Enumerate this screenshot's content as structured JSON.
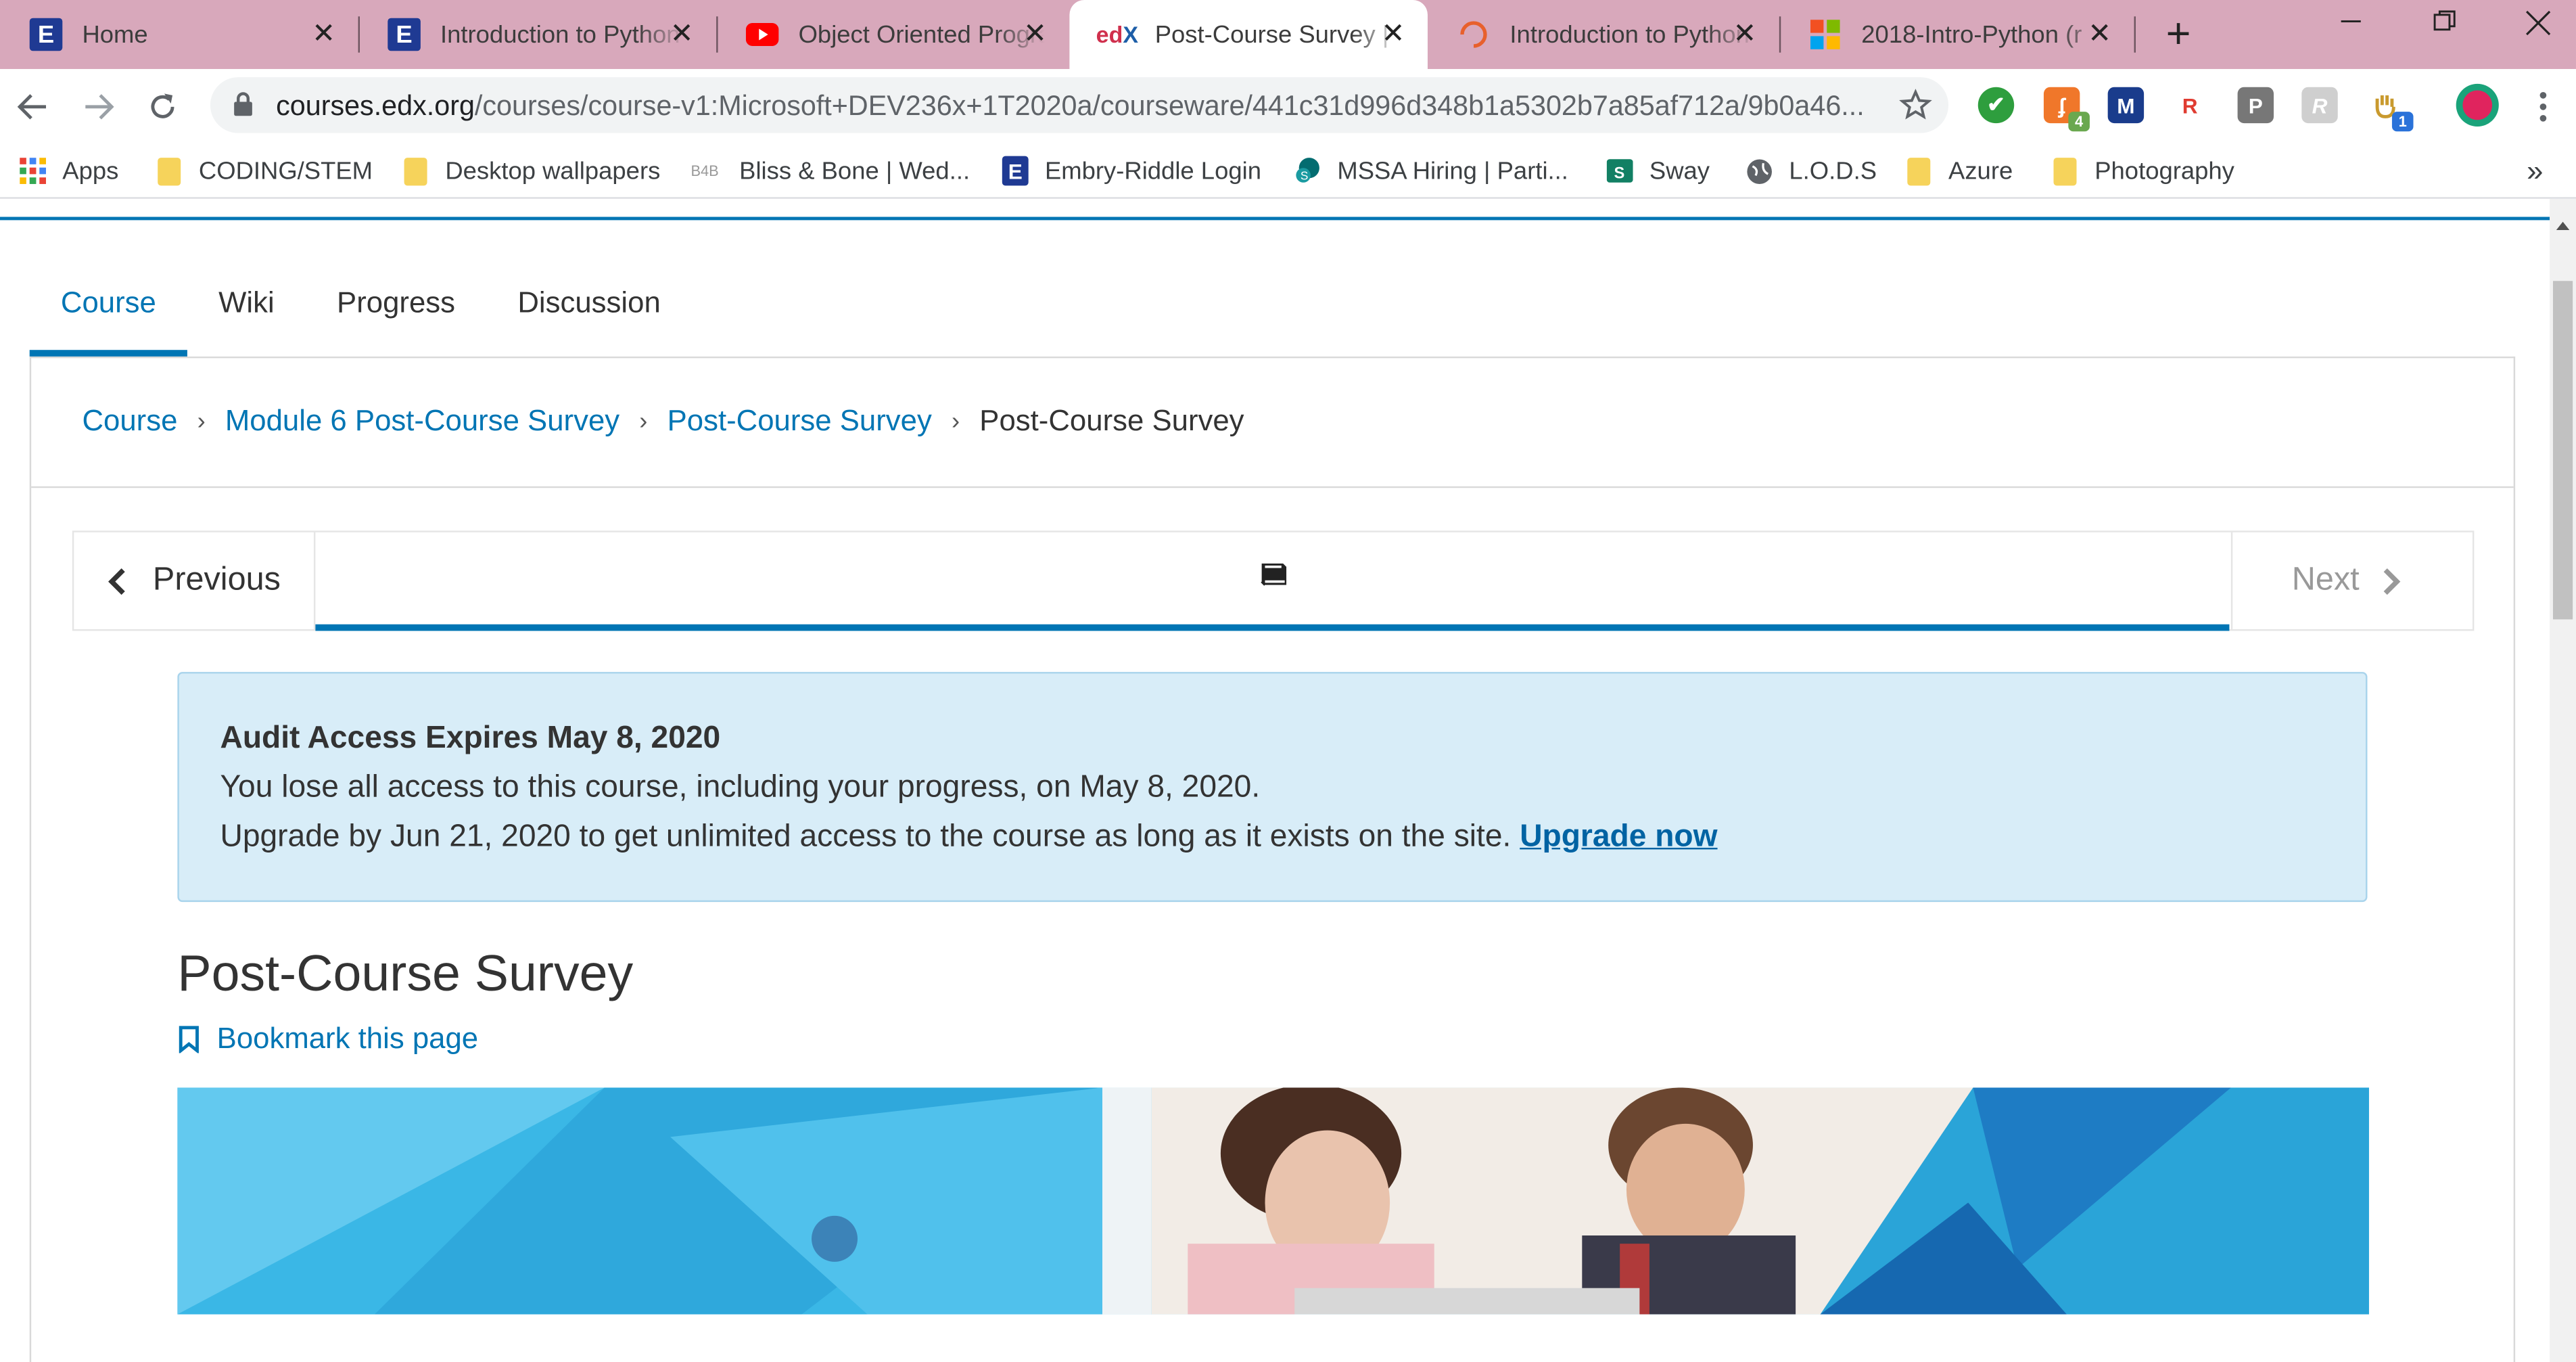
{
  "browser": {
    "tabs": [
      {
        "title": "Home",
        "icon": "edx-e-icon",
        "active": false
      },
      {
        "title": "Introduction to Python",
        "icon": "edx-e-icon",
        "active": false
      },
      {
        "title": "Object Oriented Programming",
        "icon": "youtube-icon",
        "active": false
      },
      {
        "title": "Post-Course Survey | ",
        "icon": "edx-logo-icon",
        "active": true
      },
      {
        "title": "Introduction to Python",
        "icon": "loading-spinner-icon",
        "active": false
      },
      {
        "title": "2018-Intro-Python (r",
        "icon": "microsoft-icon",
        "active": false
      }
    ],
    "url_host": "courses.edx.org",
    "url_path": "/courses/course-v1:Microsoft+DEV236x+1T2020a/courseware/441c31d996d348b1a5302b7a85af712a/9b0a46...",
    "extensions": [
      {
        "icon": "check-extension-icon",
        "color": "#2e9e3e"
      },
      {
        "icon": "orange-extension-icon",
        "color": "#f0772a",
        "badge": "4"
      },
      {
        "icon": "m-extension-icon",
        "color": "#1a3c8c",
        "label": "M"
      },
      {
        "icon": "r-extension-icon",
        "color": "#e03c31",
        "label": "R"
      },
      {
        "icon": "p-extension-icon",
        "color": "#777777",
        "label": "P"
      },
      {
        "icon": "r-script-extension-icon",
        "color": "#cfcfcf",
        "label": "R"
      },
      {
        "icon": "hand-extension-icon",
        "color": "#e8b43a",
        "badge": "1"
      }
    ],
    "bookmarks": [
      {
        "label": "Apps",
        "icon": "apps-grid-icon"
      },
      {
        "label": "CODING/STEM",
        "icon": "folder-icon"
      },
      {
        "label": "Desktop wallpapers",
        "icon": "folder-icon"
      },
      {
        "label": "Bliss & Bone | Wed...",
        "icon": "b4b-icon"
      },
      {
        "label": "Embry-Riddle Login",
        "icon": "erau-e-icon"
      },
      {
        "label": "MSSA Hiring | Parti...",
        "icon": "sharepoint-icon"
      },
      {
        "label": "Sway",
        "icon": "sway-icon"
      },
      {
        "label": "L.O.D.S",
        "icon": "globe-icon"
      },
      {
        "label": "Azure",
        "icon": "folder-icon"
      },
      {
        "label": "Photography",
        "icon": "folder-icon"
      }
    ]
  },
  "course_nav": {
    "tabs": [
      "Course",
      "Wiki",
      "Progress",
      "Discussion"
    ],
    "active": "Course"
  },
  "breadcrumb": {
    "links": [
      "Course",
      "Module 6 Post-Course Survey",
      "Post-Course Survey"
    ],
    "current": "Post-Course Survey"
  },
  "sequence_nav": {
    "previous_label": "Previous",
    "next_label": "Next",
    "unit_icon": "book-icon"
  },
  "alert": {
    "heading": "Audit Access Expires May 8, 2020",
    "line1": "You lose all access to this course, including your progress, on May 8, 2020.",
    "line2": "Upgrade by Jun 21, 2020 to get unlimited access to the course as long as it exists on the site.",
    "link": "Upgrade now"
  },
  "page_title": "Post-Course Survey",
  "bookmark_label": "Bookmark this page",
  "colors": {
    "accent": "#0075b4",
    "tabstrip": "#d8a8bb",
    "alert_bg": "#d8edf8",
    "banner_cyan": "#3ab7e6"
  }
}
